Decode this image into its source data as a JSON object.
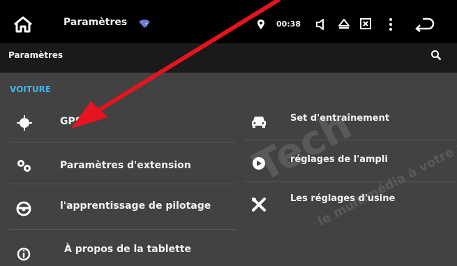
{
  "status_bar": {
    "title": "Paramètres",
    "time": "00:38"
  },
  "app_bar": {
    "title": "Paramètres"
  },
  "section": {
    "title": "VOITURE"
  },
  "left_items": [
    {
      "label": "GPS",
      "icon": "gps-icon"
    },
    {
      "label": "Paramètres d'extension",
      "icon": "gears-icon"
    },
    {
      "label": "l'apprentissage de pilotage",
      "icon": "steering-wheel-icon"
    },
    {
      "label": "À propos de la tablette",
      "icon": "info-icon"
    }
  ],
  "right_items": [
    {
      "label": "Set d'entraînement",
      "icon": "car-icon"
    },
    {
      "label": "réglages de l'ampli",
      "icon": "amplifier-icon"
    },
    {
      "label": "Les réglages d'usine",
      "icon": "tools-icon"
    }
  ],
  "colors": {
    "background": "#424242",
    "status_bar": "#000000",
    "app_bar": "#1a1a1a",
    "section_accent": "#3fb8e6",
    "annotation_arrow": "#e6141e"
  }
}
